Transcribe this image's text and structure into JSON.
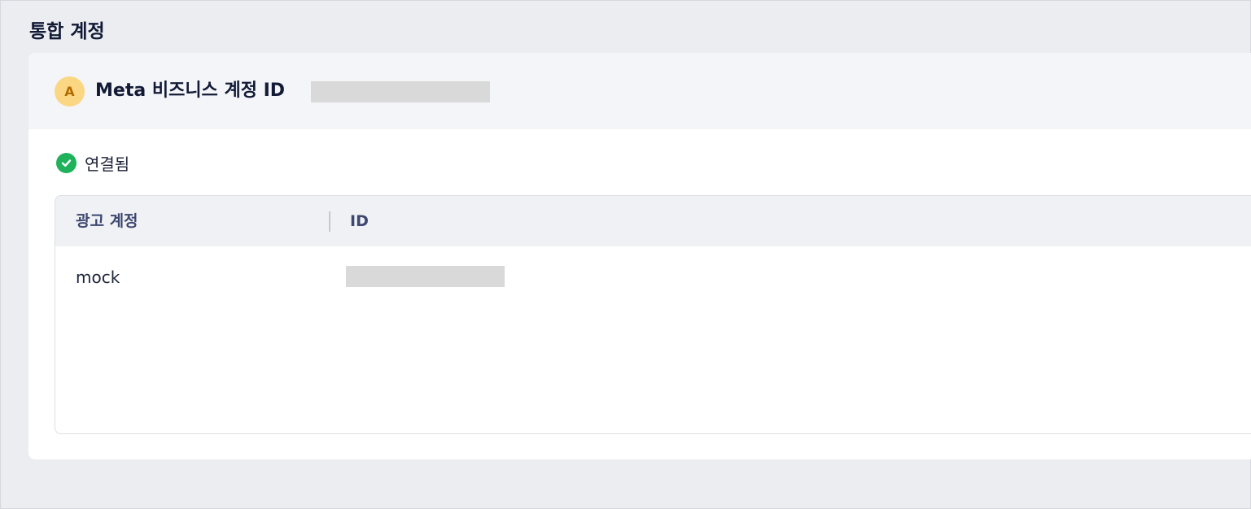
{
  "section": {
    "title": "통합 계정"
  },
  "account": {
    "avatar_letter": "A",
    "title": "Meta 비즈니스 계정 ID"
  },
  "status": {
    "label": "연결됨",
    "icon": "check-circle-icon",
    "color": "#1fb25a"
  },
  "table": {
    "columns": [
      "광고 계정",
      "ID"
    ],
    "rows": [
      {
        "name": "mock"
      }
    ]
  },
  "colors": {
    "background": "#ecedf1",
    "card": "#ffffff",
    "header_bg": "#f4f5f8",
    "avatar_bg": "#fbd784",
    "avatar_text": "#b36a00",
    "title_text": "#121a36",
    "column_header_text": "#3d4770",
    "redaction": "#d9d9d9"
  }
}
